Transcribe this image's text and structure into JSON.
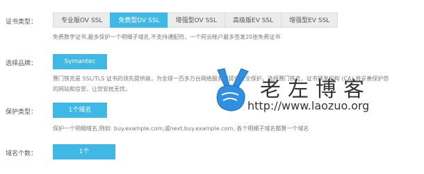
{
  "cert_type": {
    "label": "证书类型：",
    "tabs": [
      {
        "label": "专业版OV SSL"
      },
      {
        "label": "免费型DV SSL"
      },
      {
        "label": "增强型OV SSL"
      },
      {
        "label": "高级版EV SSL"
      },
      {
        "label": "增强型EV SSL"
      }
    ],
    "active_tab": "免费型DV SSL",
    "description": "免费数字证书,最多保护一个明细子域名,不支持通配符，一个阿云帐户最多签发20张免费证书"
  },
  "brand": {
    "label": "选择品牌：",
    "button": "Symantec",
    "description_line1": "赛门铁克是 SSL/TLS 证书的领先提供商，为全球一百多万台网络服务器提供安全保护。选择赛门铁克，证书颁发机构 (CA) 将妥善保护您",
    "description_line2": "的网站和信誉，让您安枕无忧。"
  },
  "protection": {
    "label": "保护类型：",
    "button": "1个域名",
    "description": "保护一个明细域名,例如: buy.example.com,或next.buy.example.com, 各个明细子域名都算一个域名"
  },
  "domain_count": {
    "label": "域名个数：",
    "button": "1个"
  },
  "watermark": {
    "title": "老左博客",
    "url": "http://www.laozuo.org"
  },
  "colors": {
    "accent": "#3fb8e6",
    "tab_bg": "#ececec"
  }
}
